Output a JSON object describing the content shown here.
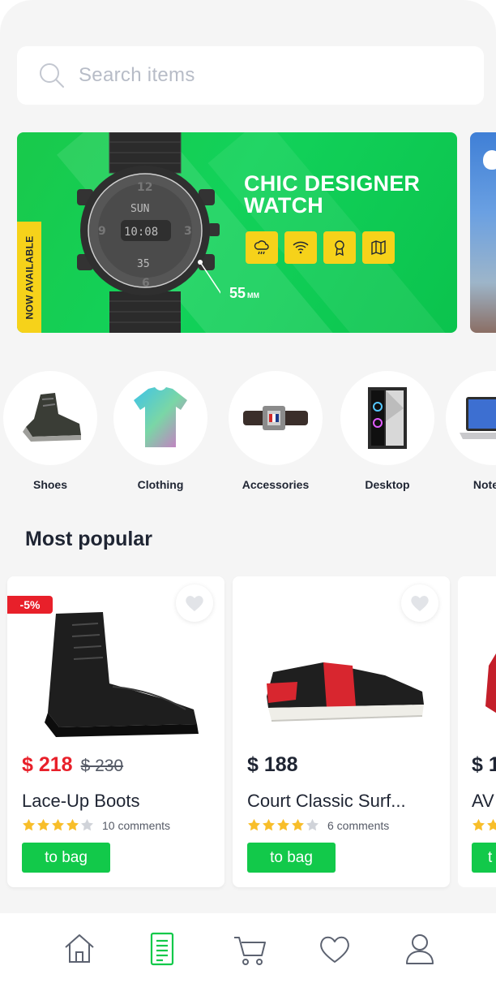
{
  "search": {
    "placeholder": "Search items",
    "icon": "search-icon"
  },
  "banner": {
    "badge": "NOW AVAILABLE",
    "title_line1": "CHIC DESIGNER",
    "title_line2": "WATCH",
    "size_value": "55",
    "size_unit": "MM",
    "features": [
      "weather-icon",
      "wifi-icon",
      "award-icon",
      "map-icon"
    ],
    "accent_color": "#f6d21a",
    "background_color": "#12d25a"
  },
  "categories": [
    {
      "label": "Shoes"
    },
    {
      "label": "Clothing"
    },
    {
      "label": "Accessories"
    },
    {
      "label": "Desktop"
    },
    {
      "label": "Notebo"
    }
  ],
  "section": {
    "title": "Most popular"
  },
  "products": [
    {
      "badge": "-5%",
      "price": "$ 218",
      "old_price": "$ 230",
      "name": "Lace-Up Boots",
      "rating": 4,
      "comments": "10 comments",
      "button": "to bag"
    },
    {
      "price": "$ 188",
      "name": "Court Classic Surf...",
      "rating": 4,
      "comments": "6 comments",
      "button": "to bag"
    },
    {
      "price": "$ 1",
      "name": "AV",
      "button": "t"
    }
  ],
  "nav": {
    "items": [
      "home-icon",
      "catalog-icon",
      "cart-icon",
      "favorites-icon",
      "profile-icon"
    ],
    "active": "catalog-icon",
    "active_color": "#12c94a"
  }
}
